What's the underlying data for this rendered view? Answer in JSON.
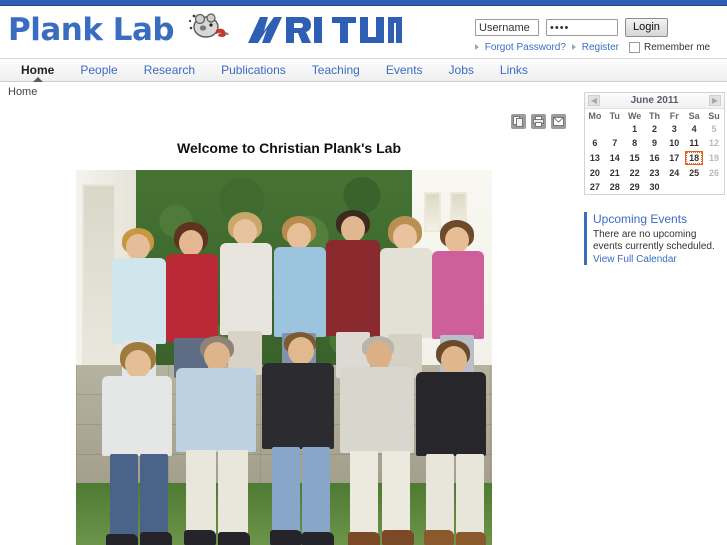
{
  "site": {
    "brand_text": "Plank Lab",
    "logo_icons": [
      "mouse-magnet-icon",
      "mri-logo",
      "tum-logo"
    ],
    "accent_blue": "#3a6cc0",
    "top_strip_color": "#2f5fb5"
  },
  "login": {
    "username_value": "Username",
    "username_placeholder": "Username",
    "password_value": "••••",
    "password_placeholder": "Password",
    "login_label": "Login",
    "forgot_label": "Forgot Password?",
    "register_label": "Register",
    "remember_label": "Remember me",
    "remember_checked": false
  },
  "nav": {
    "items": [
      {
        "label": "Home",
        "active": true
      },
      {
        "label": "People",
        "active": false
      },
      {
        "label": "Research",
        "active": false
      },
      {
        "label": "Publications",
        "active": false
      },
      {
        "label": "Teaching",
        "active": false
      },
      {
        "label": "Events",
        "active": false
      },
      {
        "label": "Jobs",
        "active": false
      },
      {
        "label": "Links",
        "active": false
      }
    ]
  },
  "breadcrumb": {
    "text": "Home"
  },
  "main": {
    "page_title": "Welcome to Christian Plank's Lab",
    "tools": [
      {
        "name": "copy-icon",
        "title": "Copy"
      },
      {
        "name": "print-icon",
        "title": "Print"
      },
      {
        "name": "email-icon",
        "title": "Email"
      }
    ],
    "photo_alt": "Group photo of the Plank Lab team in front of a stone wall"
  },
  "sidebar": {
    "calendar": {
      "title": "June 2011",
      "prev_label": "◀",
      "next_label": "▶",
      "weekdays": [
        "Mo",
        "Tu",
        "We",
        "Th",
        "Fr",
        "Sa",
        "Su"
      ],
      "today": 18,
      "weeks": [
        [
          "",
          "",
          "1",
          "2",
          "3",
          "4",
          "5"
        ],
        [
          "6",
          "7",
          "8",
          "9",
          "10",
          "11",
          "12"
        ],
        [
          "13",
          "14",
          "15",
          "16",
          "17",
          "18",
          "19"
        ],
        [
          "20",
          "21",
          "22",
          "23",
          "24",
          "25",
          "26"
        ],
        [
          "27",
          "28",
          "29",
          "30",
          "",
          "",
          ""
        ]
      ],
      "dim_column_index": 6,
      "today_outline_color": "#e4601f"
    },
    "events": {
      "heading": "Upcoming Events",
      "body": "There are no upcoming events currently scheduled.",
      "link_label": "View Full Calendar"
    }
  }
}
